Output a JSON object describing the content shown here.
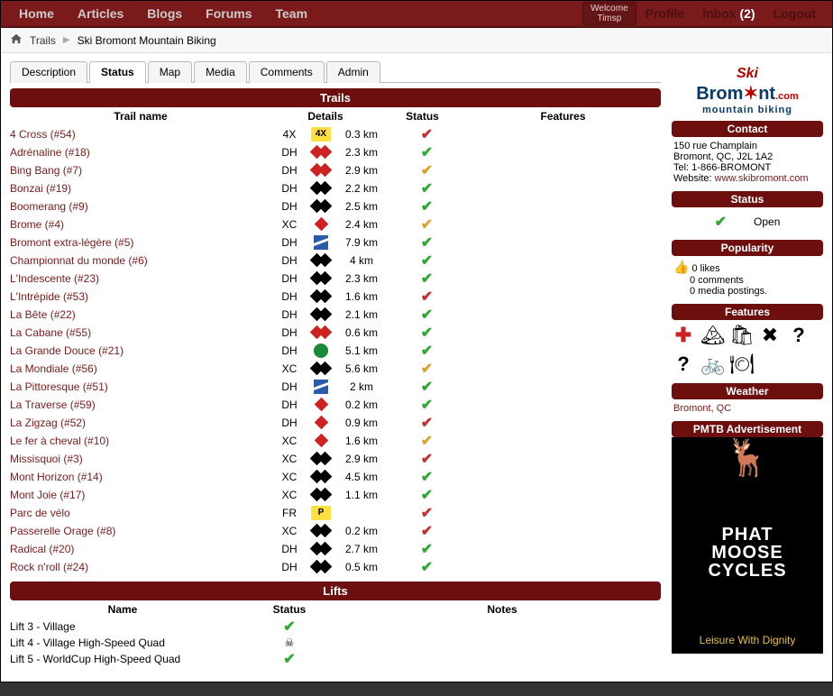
{
  "nav": {
    "home": "Home",
    "articles": "Articles",
    "blogs": "Blogs",
    "forums": "Forums",
    "team": "Team"
  },
  "welcome": {
    "label": "Welcome",
    "user": "Timsp"
  },
  "usernav": {
    "profile": "Profile",
    "inbox": "Inbox",
    "inbox_count": "(2)",
    "logout": "Logout"
  },
  "crumbs": {
    "trails": "Trails",
    "current": "Ski Bromont Mountain Biking"
  },
  "tabs": [
    "Description",
    "Status",
    "Map",
    "Media",
    "Comments",
    "Admin"
  ],
  "active_tab": 1,
  "trails_section": {
    "title": "Trails",
    "columns": {
      "name": "Trail name",
      "details": "Details",
      "status": "Status",
      "features": "Features"
    },
    "rows": [
      {
        "name": "4 Cross (#54)",
        "type": "4X",
        "icon": "badge-4x",
        "dist": "0.3 km",
        "status": "red"
      },
      {
        "name": "Adrénaline (#18)",
        "type": "DH",
        "icon": "dbl-red",
        "dist": "2.3 km",
        "status": "green"
      },
      {
        "name": "Bing Bang (#7)",
        "type": "DH",
        "icon": "dbl-red",
        "dist": "2.9 km",
        "status": "orange"
      },
      {
        "name": "Bonzai (#19)",
        "type": "DH",
        "icon": "dbl-black",
        "dist": "2.2 km",
        "status": "green"
      },
      {
        "name": "Boomerang (#9)",
        "type": "DH",
        "icon": "dbl-black",
        "dist": "2.5 km",
        "status": "green"
      },
      {
        "name": "Brome (#4)",
        "type": "XC",
        "icon": "sgl-red",
        "dist": "2.4 km",
        "status": "orange"
      },
      {
        "name": "Bromont extra-légère (#5)",
        "type": "DH",
        "icon": "blue-square",
        "dist": "7.9 km",
        "status": "green"
      },
      {
        "name": "Championnat du monde (#6)",
        "type": "DH",
        "icon": "dbl-black",
        "dist": "4 km",
        "status": "green"
      },
      {
        "name": "L'Indescente (#23)",
        "type": "DH",
        "icon": "dbl-black",
        "dist": "2.3 km",
        "status": "green"
      },
      {
        "name": "L'Intrépide (#53)",
        "type": "DH",
        "icon": "dbl-black",
        "dist": "1.6 km",
        "status": "red"
      },
      {
        "name": "La Bête (#22)",
        "type": "DH",
        "icon": "dbl-black",
        "dist": "2.1 km",
        "status": "green"
      },
      {
        "name": "La Cabane (#55)",
        "type": "DH",
        "icon": "dbl-red",
        "dist": "0.6 km",
        "status": "green"
      },
      {
        "name": "La Grande Douce (#21)",
        "type": "DH",
        "icon": "green-circle",
        "dist": "5.1 km",
        "status": "green"
      },
      {
        "name": "La Mondiale (#56)",
        "type": "XC",
        "icon": "dbl-black",
        "dist": "5.6 km",
        "status": "orange"
      },
      {
        "name": "La Pittoresque (#51)",
        "type": "DH",
        "icon": "blue-square",
        "dist": "2 km",
        "status": "green"
      },
      {
        "name": "La Traverse (#59)",
        "type": "DH",
        "icon": "sgl-red",
        "dist": "0.2 km",
        "status": "green"
      },
      {
        "name": "La Zigzag (#52)",
        "type": "DH",
        "icon": "sgl-red",
        "dist": "0.9 km",
        "status": "red"
      },
      {
        "name": "Le fer à cheval (#10)",
        "type": "XC",
        "icon": "sgl-red",
        "dist": "1.6 km",
        "status": "orange"
      },
      {
        "name": "Missisquoi (#3)",
        "type": "XC",
        "icon": "dbl-black",
        "dist": "2.9 km",
        "status": "red"
      },
      {
        "name": "Mont Horizon (#14)",
        "type": "XC",
        "icon": "dbl-black",
        "dist": "4.5 km",
        "status": "green"
      },
      {
        "name": "Mont Joie (#17)",
        "type": "XC",
        "icon": "dbl-black",
        "dist": "1.1 km",
        "status": "green"
      },
      {
        "name": "Parc de vélo",
        "type": "FR",
        "icon": "badge-p",
        "dist": "",
        "status": "red"
      },
      {
        "name": "Passerelle Orage (#8)",
        "type": "XC",
        "icon": "dbl-black",
        "dist": "0.2 km",
        "status": "red"
      },
      {
        "name": "Radical (#20)",
        "type": "DH",
        "icon": "dbl-black",
        "dist": "2.7 km",
        "status": "green"
      },
      {
        "name": "Rock n'roll (#24)",
        "type": "DH",
        "icon": "dbl-black",
        "dist": "0.5 km",
        "status": "green"
      }
    ]
  },
  "lifts_section": {
    "title": "Lifts",
    "columns": {
      "name": "Name",
      "status": "Status",
      "notes": "Notes"
    },
    "rows": [
      {
        "name": "Lift 3 - Village",
        "status": "green"
      },
      {
        "name": "Lift 4 - Village High-Speed Quad",
        "status": "closed"
      },
      {
        "name": "Lift 5 - WorldCup High-Speed Quad",
        "status": "green"
      }
    ]
  },
  "side": {
    "logo": {
      "brand1": "Ski",
      "brand2a": "Brom",
      "brand2b": "nt",
      "com": ".com",
      "sub": "mountain biking"
    },
    "contact": {
      "title": "Contact",
      "addr1": "150 rue Champlain",
      "addr2": "Bromont, QC, J2L 1A2",
      "tel": "Tel: 1-866-BROMONT",
      "web_label": "Website: ",
      "web": "www.skibromont.com"
    },
    "status": {
      "title": "Status",
      "value": "Open"
    },
    "popularity": {
      "title": "Popularity",
      "likes": "0 likes",
      "comments": "0 comments",
      "media": "0 media postings."
    },
    "features": {
      "title": "Features"
    },
    "weather": {
      "title": "Weather",
      "link": "Bromont, QC"
    },
    "ad": {
      "title": "PMTB Advertisement",
      "line1": "PHAT",
      "line2": "MOOSE",
      "line3": "CYCLES",
      "tag": "Leisure With Dignity"
    }
  }
}
